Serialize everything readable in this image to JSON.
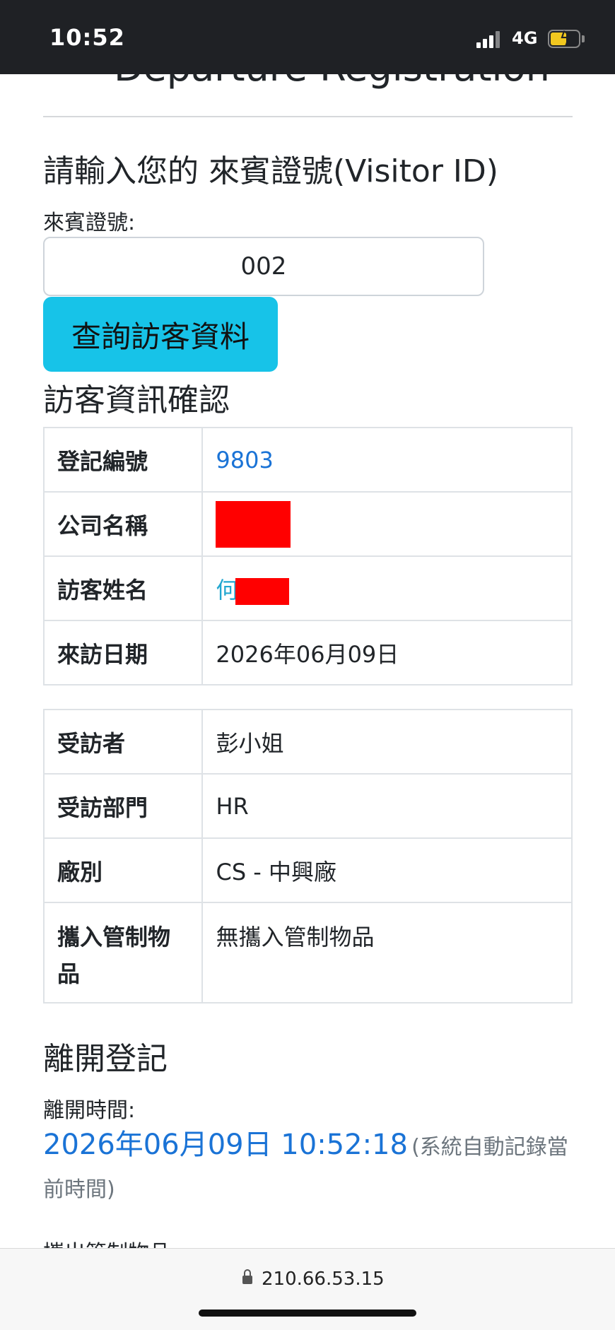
{
  "status_bar": {
    "time": "10:52",
    "network": "4G"
  },
  "page": {
    "heading_partial": "Departure Registration",
    "visitor_id_section": {
      "title": "請輸入您的 來賓證號(Visitor ID)",
      "field_label": "來賓證號:",
      "field_value": "002",
      "query_button": "查詢訪客資料"
    },
    "confirm_section": {
      "title": "訪客資訊確認",
      "rows": [
        {
          "key": "登記編號",
          "value": "9803"
        },
        {
          "key": "公司名稱",
          "value": ""
        },
        {
          "key": "訪客姓名",
          "value": "何"
        },
        {
          "key": "來訪日期",
          "value": "2026年06月09日"
        }
      ],
      "rows2": [
        {
          "key": "受訪者",
          "value": "彭小姐"
        },
        {
          "key": "受訪部門",
          "value": "HR"
        },
        {
          "key": "廠別",
          "value": "CS - 中興廠"
        },
        {
          "key": "攜入管制物品",
          "value": "無攜入管制物品"
        }
      ]
    },
    "departure_section": {
      "title": "離開登記",
      "time_label": "離開時間:",
      "time_value": "2026年06月09日 10:52:18",
      "time_note": "(系統自動記錄當前時間)",
      "next_label_partial": "攜出管制物品:"
    }
  },
  "browser": {
    "url": "210.66.53.15"
  },
  "colors": {
    "accent_button": "#17c3e8",
    "link_blue": "#1a73d6",
    "redaction": "#ff0000"
  }
}
